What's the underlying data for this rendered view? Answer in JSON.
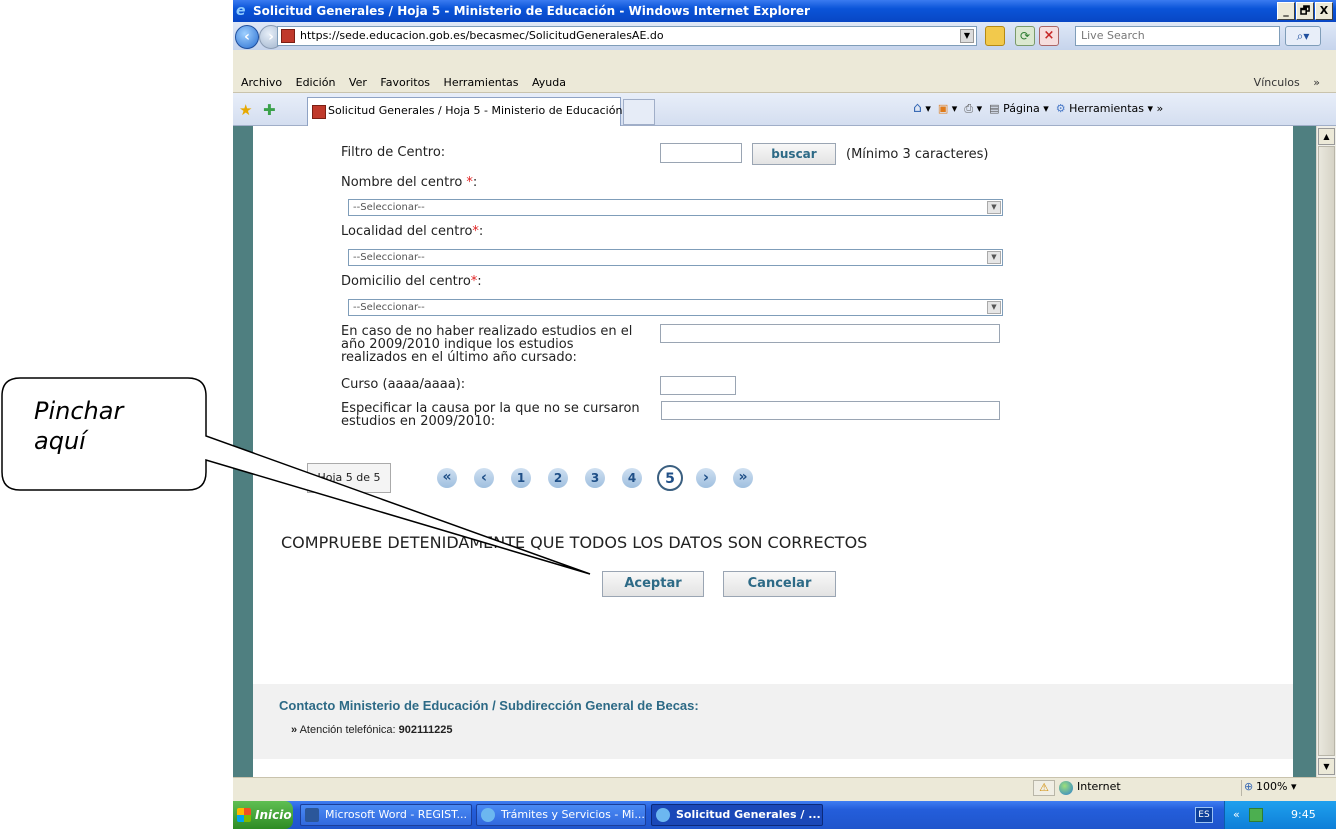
{
  "window": {
    "title": "Solicitud Generales / Hoja 5 - Ministerio de Educación - Windows Internet Explorer",
    "minimize": "_",
    "maximize": "🗗",
    "close": "X"
  },
  "address": {
    "url": "https://sede.educacion.gob.es/becasmec/SolicitudGeneralesAE.do",
    "search_placeholder": "Live Search"
  },
  "menu": {
    "items": [
      "Archivo",
      "Edición",
      "Ver",
      "Favoritos",
      "Herramientas",
      "Ayuda"
    ],
    "links_label": "Vínculos"
  },
  "tabs": {
    "active_title": "Solicitud Generales / Hoja 5 - Ministerio de Educación"
  },
  "commandbar": {
    "page_label": "Página",
    "tools_label": "Herramientas"
  },
  "form": {
    "filtro_label": "Filtro de Centro:",
    "buscar_label": "buscar",
    "minimo_hint": "(Mínimo 3 caracteres)",
    "nombre_label": "Nombre del centro ",
    "localidad_label": "Localidad del centro",
    "domicilio_label": "Domicilio del centro",
    "required_mark": "*",
    "colon": ":",
    "select_placeholder": "--Seleccionar--",
    "estudios_label_1": "En caso de no haber realizado estudios en el",
    "estudios_label_2": "año 2009/2010 indique los estudios",
    "estudios_label_3": "realizados en el último año cursado:",
    "curso_label": "Curso (aaaa/aaaa):",
    "causa_label_1": "Especificar la causa por la que no se cursaron",
    "causa_label_2": "estudios en 2009/2010:"
  },
  "pagination": {
    "sheet_label": "Hoja 5 de 5",
    "first": "«",
    "prev": "‹",
    "pages": [
      "1",
      "2",
      "3",
      "4",
      "5"
    ],
    "current_page": "5",
    "next": "›",
    "last": "»"
  },
  "confirm": {
    "message": "COMPRUEBE DETENIDAMENTE QUE TODOS LOS DATOS SON CORRECTOS",
    "accept": "Aceptar",
    "cancel": "Cancelar"
  },
  "footer": {
    "contact_title": "Contacto Ministerio de Educación / Subdirección General de Becas:",
    "bullet": "»",
    "phone_label": "Atención telefónica:",
    "phone_number": "902111225"
  },
  "status": {
    "zone": "Internet",
    "zoom": "100%"
  },
  "taskbar": {
    "start": "Inicio",
    "tasks": [
      "Microsoft Word - REGIST...",
      "Trámites y Servicios - Mi...",
      "Solicitud Generales / ..."
    ],
    "language": "ES",
    "time": "9:45"
  },
  "annotation": {
    "line1": "Pinchar",
    "line2": "aquí"
  },
  "colors": {
    "side_bars": "#4f7f80",
    "button_text": "#2d6a86",
    "required": "#e02020",
    "footer_title": "#2d6a86"
  }
}
